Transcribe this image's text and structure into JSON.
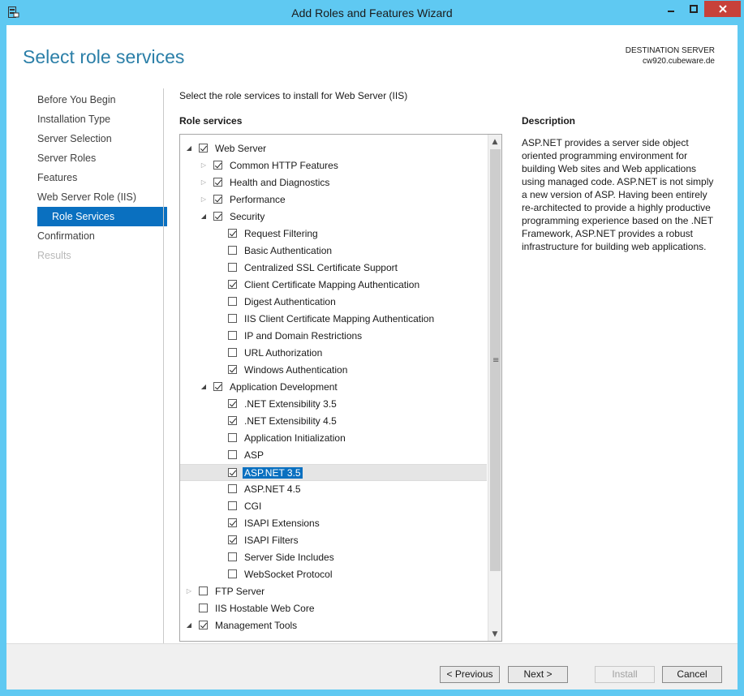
{
  "window": {
    "title": "Add Roles and Features Wizard"
  },
  "header": {
    "page_title": "Select role services",
    "destination_label": "DESTINATION SERVER",
    "destination_server": "cw920.cubeware.de"
  },
  "nav": {
    "items": [
      {
        "label": "Before You Begin",
        "state": "normal"
      },
      {
        "label": "Installation Type",
        "state": "normal"
      },
      {
        "label": "Server Selection",
        "state": "normal"
      },
      {
        "label": "Server Roles",
        "state": "normal"
      },
      {
        "label": "Features",
        "state": "normal"
      },
      {
        "label": "Web Server Role (IIS)",
        "state": "normal"
      },
      {
        "label": "Role Services",
        "state": "active"
      },
      {
        "label": "Confirmation",
        "state": "normal"
      },
      {
        "label": "Results",
        "state": "disabled"
      }
    ]
  },
  "main": {
    "intro": "Select the role services to install for Web Server (IIS)",
    "role_services_heading": "Role services",
    "tree": [
      {
        "label": "Web Server",
        "level": 0,
        "checked": true,
        "expander": "expanded"
      },
      {
        "label": "Common HTTP Features",
        "level": 1,
        "checked": true,
        "expander": "collapsed"
      },
      {
        "label": "Health and Diagnostics",
        "level": 1,
        "checked": true,
        "expander": "collapsed"
      },
      {
        "label": "Performance",
        "level": 1,
        "checked": true,
        "expander": "collapsed"
      },
      {
        "label": "Security",
        "level": 1,
        "checked": true,
        "expander": "expanded"
      },
      {
        "label": "Request Filtering",
        "level": 2,
        "checked": true,
        "expander": "none"
      },
      {
        "label": "Basic Authentication",
        "level": 2,
        "checked": false,
        "expander": "none"
      },
      {
        "label": "Centralized SSL Certificate Support",
        "level": 2,
        "checked": false,
        "expander": "none"
      },
      {
        "label": "Client Certificate Mapping Authentication",
        "level": 2,
        "checked": true,
        "expander": "none"
      },
      {
        "label": "Digest Authentication",
        "level": 2,
        "checked": false,
        "expander": "none"
      },
      {
        "label": "IIS Client Certificate Mapping Authentication",
        "level": 2,
        "checked": false,
        "expander": "none"
      },
      {
        "label": "IP and Domain Restrictions",
        "level": 2,
        "checked": false,
        "expander": "none"
      },
      {
        "label": "URL Authorization",
        "level": 2,
        "checked": false,
        "expander": "none"
      },
      {
        "label": "Windows Authentication",
        "level": 2,
        "checked": true,
        "expander": "none"
      },
      {
        "label": "Application Development",
        "level": 1,
        "checked": true,
        "expander": "expanded"
      },
      {
        "label": ".NET Extensibility 3.5",
        "level": 2,
        "checked": true,
        "expander": "none"
      },
      {
        "label": ".NET Extensibility 4.5",
        "level": 2,
        "checked": true,
        "expander": "none"
      },
      {
        "label": "Application Initialization",
        "level": 2,
        "checked": false,
        "expander": "none"
      },
      {
        "label": "ASP",
        "level": 2,
        "checked": false,
        "expander": "none"
      },
      {
        "label": "ASP.NET 3.5",
        "level": 2,
        "checked": true,
        "expander": "none",
        "selected": true
      },
      {
        "label": "ASP.NET 4.5",
        "level": 2,
        "checked": false,
        "expander": "none"
      },
      {
        "label": "CGI",
        "level": 2,
        "checked": false,
        "expander": "none"
      },
      {
        "label": "ISAPI Extensions",
        "level": 2,
        "checked": true,
        "expander": "none"
      },
      {
        "label": "ISAPI Filters",
        "level": 2,
        "checked": true,
        "expander": "none"
      },
      {
        "label": "Server Side Includes",
        "level": 2,
        "checked": false,
        "expander": "none"
      },
      {
        "label": "WebSocket Protocol",
        "level": 2,
        "checked": false,
        "expander": "none"
      },
      {
        "label": "FTP Server",
        "level": 0,
        "checked": false,
        "expander": "collapsed"
      },
      {
        "label": "IIS Hostable Web Core",
        "level": 0,
        "checked": false,
        "expander": "none"
      },
      {
        "label": "Management Tools",
        "level": 0,
        "checked": true,
        "expander": "expanded"
      }
    ]
  },
  "description": {
    "heading": "Description",
    "text": "ASP.NET provides a server side object oriented programming environment for building Web sites and Web applications using managed code. ASP.NET is not simply a new version of ASP. Having been entirely re-architected to provide a highly productive programming experience based on the .NET Framework, ASP.NET provides a robust infrastructure for building web applications."
  },
  "footer": {
    "previous_label": "< Previous",
    "next_label": "Next >",
    "install_label": "Install",
    "cancel_label": "Cancel"
  },
  "colors": {
    "accent": "#0a70c0",
    "title_blue": "#2b7fa8",
    "frame": "#5fc9f2",
    "close_button": "#c7413a"
  }
}
